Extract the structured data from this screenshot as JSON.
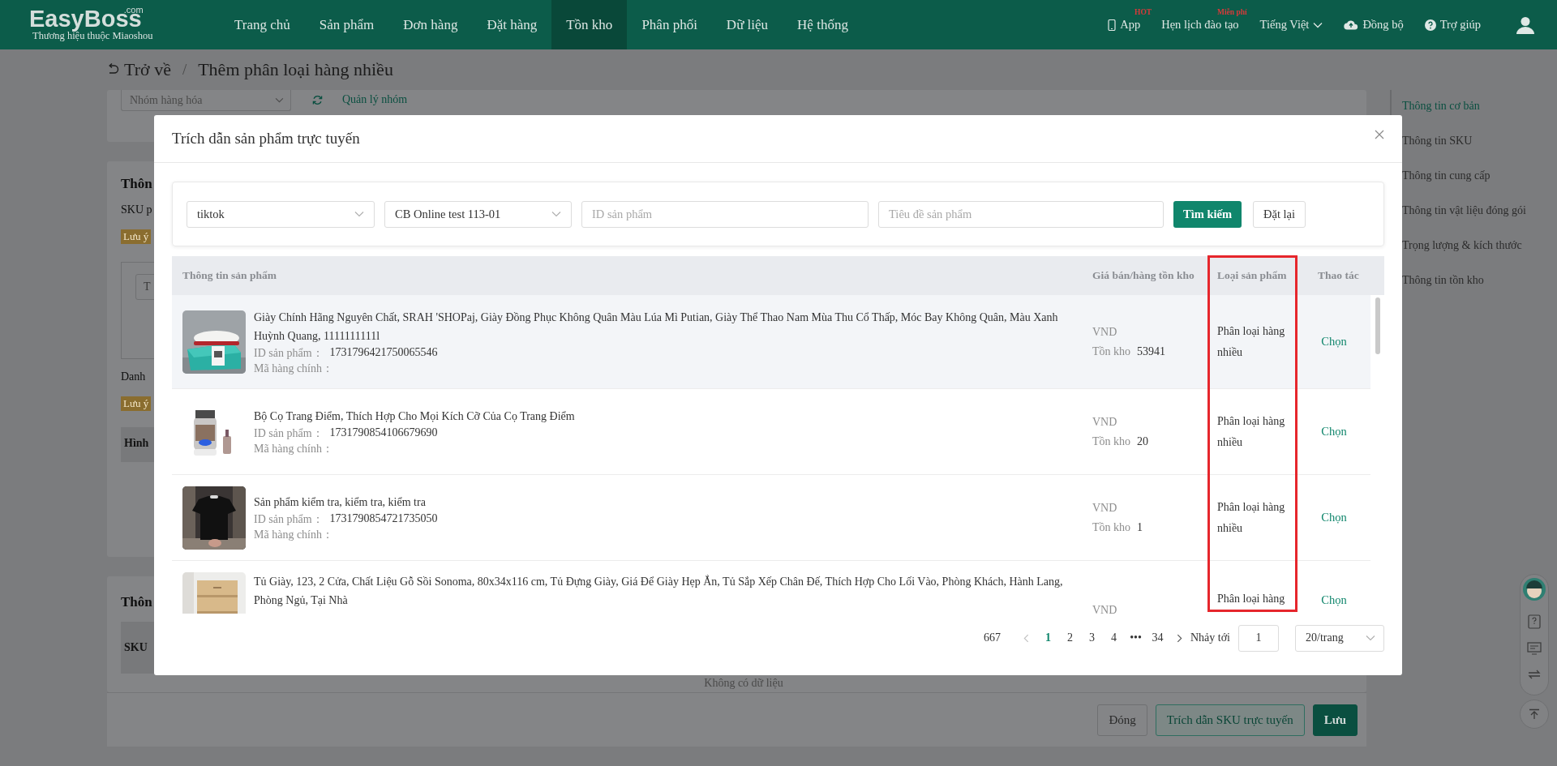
{
  "header": {
    "logo": "EasyBoss",
    "logo_suffix": ".com",
    "tagline": "Thương hiệu thuộc Miaoshou",
    "nav": [
      {
        "label": "Trang chủ",
        "selected": false
      },
      {
        "label": "Sản phẩm",
        "selected": false
      },
      {
        "label": "Đơn hàng",
        "selected": false
      },
      {
        "label": "Đặt hàng",
        "selected": false
      },
      {
        "label": "Tồn kho",
        "selected": true
      },
      {
        "label": "Phân phối",
        "selected": false
      },
      {
        "label": "Dữ liệu",
        "selected": false
      },
      {
        "label": "Hệ thống",
        "selected": false
      }
    ],
    "tools": [
      {
        "kind": "app",
        "label": "App",
        "badge": "HOT"
      },
      {
        "kind": "training",
        "label": "Hẹn lịch đào tạo",
        "badge": "Miễn phí"
      },
      {
        "kind": "language",
        "label": "Tiếng Việt"
      },
      {
        "kind": "sync",
        "label": "Đồng bộ"
      },
      {
        "kind": "help",
        "label": "Trợ giúp"
      }
    ]
  },
  "breadcrumb": {
    "back": "Trở về",
    "separator": "/",
    "current": "Thêm phân loại hàng nhiều"
  },
  "background": {
    "group_select": {
      "placeholder": "Nhóm hàng hóa"
    },
    "group_link": "Quản lý nhóm",
    "section_1": {
      "heading": "Thôn",
      "line": "SKU p",
      "note": "Lưu ý",
      "field": "T",
      "list_label": "Danh",
      "note_2": "Lưu ý",
      "table_header": "Hình"
    },
    "section_2": {
      "heading": "Thôn",
      "table_header": "SKU",
      "empty": "Không có dữ liệu"
    }
  },
  "footer_buttons": [
    {
      "label": "Đóng",
      "kind": "default"
    },
    {
      "label": "Trích dẫn SKU trực tuyến",
      "kind": "outline"
    },
    {
      "label": "Lưu",
      "kind": "primary"
    }
  ],
  "side_nav": [
    {
      "label": "Thông tin cơ bản",
      "selected": true
    },
    {
      "label": "Thông tin SKU",
      "selected": false
    },
    {
      "label": "Thông tin cung cấp",
      "selected": false
    },
    {
      "label": "Thông tin vật liệu đóng gói",
      "selected": false
    },
    {
      "label": "Trọng lượng & kích thước",
      "selected": false
    },
    {
      "label": "Thông tin tồn kho",
      "selected": false
    }
  ],
  "modal": {
    "title": "Trích dẫn sản phẩm trực tuyến",
    "filters": {
      "platform": "tiktok",
      "store": "CB Online test 113-01",
      "id_field": {
        "placeholder": "ID sản phẩm"
      },
      "title_field": {
        "placeholder": "Tiêu đề sản phẩm"
      },
      "search_button": "Tìm kiếm",
      "reset_button": "Đặt lại"
    },
    "table": {
      "columns": [
        "Thông tin sản phẩm",
        "Giá bán/hàng tồn kho",
        "Loại sản phẩm",
        "Thao tác"
      ],
      "rows": [
        {
          "hover": true,
          "title": "Giày Chính Hãng Nguyên Chất, SRAH 'SHOPaj, Giày Đồng Phục Không Quân Màu Lúa Mì Putian, Giày Thể Thao Nam Mùa Thu Cổ Thấp, Móc Bay Không Quân, Màu Xanh Huỳnh Quang, 1111111111l",
          "id_label": "ID sản phẩm：",
          "id": "1731796421750065546",
          "sku_label": "Mã hàng chính：",
          "currency": "VND",
          "stock_label": "Tồn kho",
          "stock": "53941",
          "type": "Phân loại hàng nhiều",
          "action": "Chọn"
        },
        {
          "hover": false,
          "title": "Bộ Cọ Trang Điểm, Thích Hợp Cho Mọi Kích Cỡ Của Cọ Trang Điểm",
          "id_label": "ID sản phẩm：",
          "id": "1731790854106679690",
          "sku_label": "Mã hàng chính：",
          "currency": "VND",
          "stock_label": "Tồn kho",
          "stock": "20",
          "type": "Phân loại hàng nhiều",
          "action": "Chọn"
        },
        {
          "hover": false,
          "title": "Sản phẩm kiểm tra, kiểm tra, kiểm tra",
          "id_label": "ID sản phẩm：",
          "id": "1731790854721735050",
          "sku_label": "Mã hàng chính：",
          "currency": "VND",
          "stock_label": "Tồn kho",
          "stock": "1",
          "type": "Phân loại hàng nhiều",
          "action": "Chọn"
        },
        {
          "hover": false,
          "title": "Tủ Giày, 123, 2 Cửa, Chất Liệu Gỗ Sồi Sonoma, 80x34x116 cm, Tủ Đựng Giày, Giá Để Giày Hẹp Ắn, Tủ Sắp Xếp Chân Đế, Thích Hợp Cho Lối Vào, Phòng Khách, Hành Lang, Phòng Ngủ, Tại Nhà",
          "currency": "VND",
          "type": "Phân loại hàng",
          "action": "Chọn"
        }
      ]
    },
    "pagination": {
      "total": "667",
      "pages": [
        {
          "label": "1",
          "selected": true
        },
        {
          "label": "2",
          "selected": false
        },
        {
          "label": "3",
          "selected": false
        },
        {
          "label": "4",
          "selected": false
        },
        {
          "label": "•••",
          "selected": false
        },
        {
          "label": "34",
          "selected": false
        }
      ],
      "jump_label": "Nhảy tới",
      "jump_value": "1",
      "page_size": "20/trang"
    }
  }
}
